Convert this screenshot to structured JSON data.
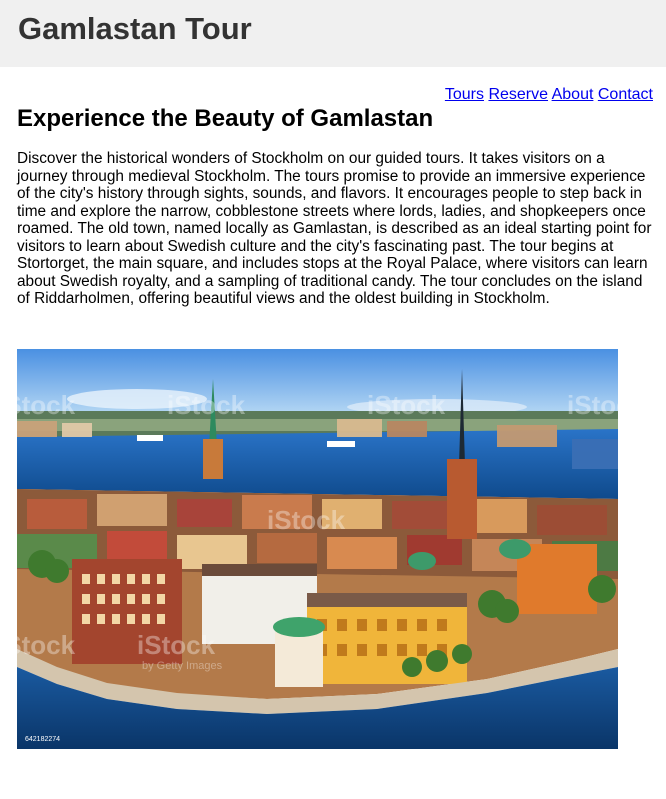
{
  "header": {
    "site_title": "Gamlastan Tour"
  },
  "nav": {
    "items": [
      {
        "label": "Tours"
      },
      {
        "label": "Reserve"
      },
      {
        "label": "About"
      },
      {
        "label": "Contact"
      }
    ]
  },
  "main": {
    "headline": "Experience the Beauty of Gamlastan",
    "intro": "Discover the historical wonders of Stockholm on our guided tours. It takes visitors on a journey through medieval Stockholm. The tours promise to provide an immersive experience of the city's history through sights, sounds, and flavors. It encourages people to step back in time and explore the narrow, cobblestone streets where lords, ladies, and shopkeepers once roamed. The old town, named locally as Gamlastan, is described as an ideal starting point for visitors to learn about Swedish culture and the city's fascinating past. The tour begins at Stortorget, the main square, and includes stops at the Royal Palace, where visitors can learn about Swedish royalty, and a sampling of traditional candy. The tour concludes on the island of Riddarholmen, offering beautiful views and the oldest building in Stockholm."
  },
  "photo": {
    "watermark": "iStock",
    "credit": "by Getty Images",
    "stock_id": "642182274"
  },
  "colors": {
    "header_bg": "#f0f0f0",
    "title_text": "#333333",
    "link": "#0000ee"
  }
}
